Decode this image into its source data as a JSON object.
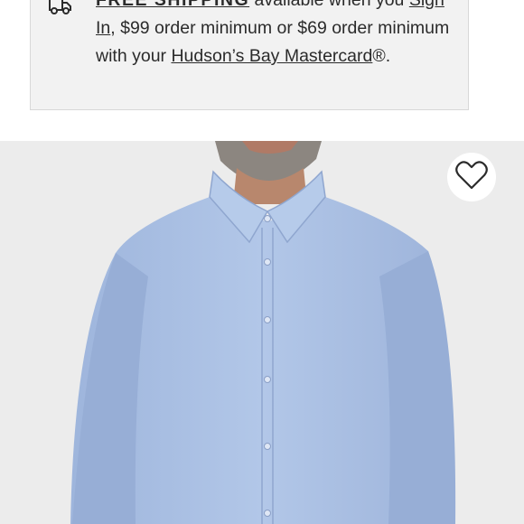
{
  "promo": {
    "icon": "truck-icon",
    "strong_label": "FREE SHIPPING",
    "text_1": " available when you ",
    "sign_in_link": "Sign In",
    "text_2": ", $99 order minimum or $69 order minimum with your ",
    "card_link": "Hudson’s Bay Mastercard",
    "text_3": "®."
  },
  "product": {
    "image_subject": "light blue dress shirt",
    "shirt_color": "#a9bfe3",
    "background_color": "#ececec"
  },
  "wishlist": {
    "icon": "heart-icon"
  }
}
